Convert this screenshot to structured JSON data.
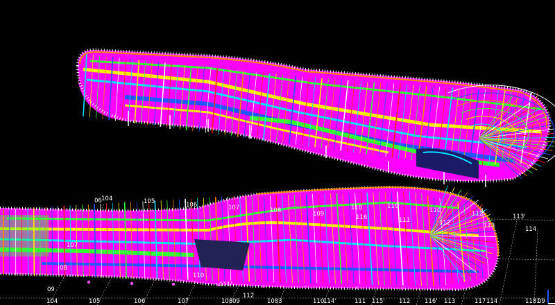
{
  "viewport": {
    "background": "#000000",
    "colors": {
      "magenta": "#ff00ff",
      "cyan": "#00e5ff",
      "yellow": "#ffee00",
      "green": "#33ff33",
      "orange": "#ff8a00",
      "blue": "#2255ff",
      "red": "#ff2222",
      "white": "#ffffff",
      "grid": "#c8c8c8"
    }
  },
  "grid_labels": [
    "06",
    "104",
    "105",
    "106",
    "107",
    "108",
    "109",
    "110",
    "110",
    "11C",
    "112'",
    "113'",
    "111",
    "112",
    "113",
    "114",
    "116",
    "107",
    "08",
    "110",
    "111'",
    "09",
    "112",
    "104",
    "105",
    "106",
    "107",
    "108",
    "09",
    "1083",
    "110",
    "114'",
    "111",
    "115'",
    "112",
    "116'",
    "113",
    "117",
    "114",
    "1181",
    "09"
  ],
  "axis_indicator": {
    "icon": "axis-triad-icon"
  }
}
